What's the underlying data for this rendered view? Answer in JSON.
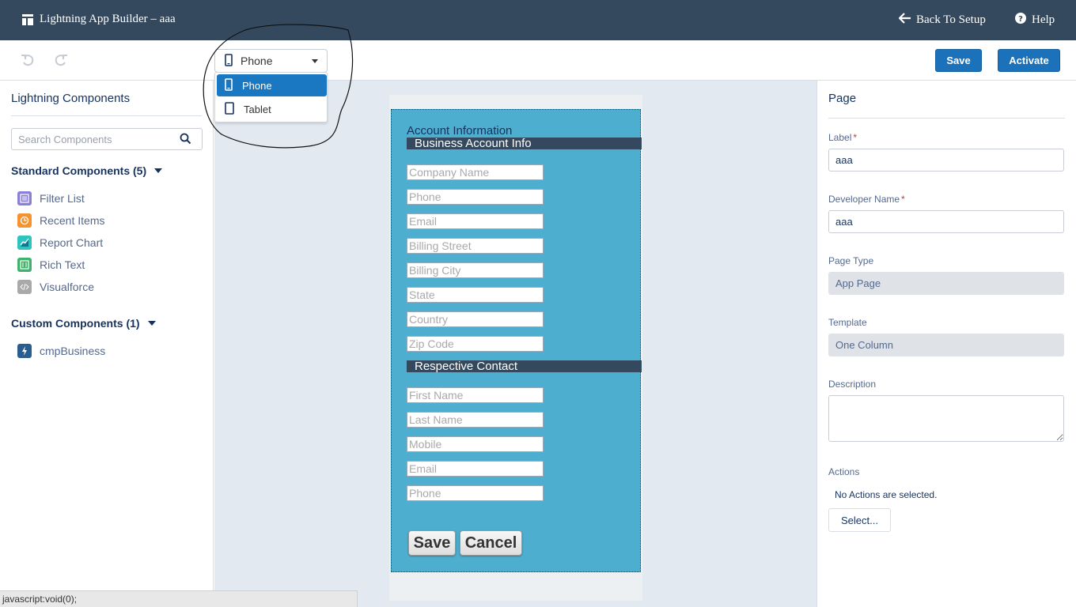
{
  "header": {
    "app_title": "Lightning App Builder – aaa",
    "back_label": "Back To Setup",
    "help_label": "Help"
  },
  "toolbar": {
    "device_selected": "Phone",
    "save_label": "Save",
    "activate_label": "Activate"
  },
  "device_menu": {
    "options": [
      "Phone",
      "Tablet"
    ],
    "selected": "Phone"
  },
  "left_panel": {
    "title": "Lightning Components",
    "search_placeholder": "Search Components",
    "standard_section": "Standard Components (5)",
    "standard_items": [
      {
        "label": "Filter List",
        "icon": "filter-list-icon",
        "color": "#8b80d4"
      },
      {
        "label": "Recent Items",
        "icon": "clock-icon",
        "color": "#f59331"
      },
      {
        "label": "Report Chart",
        "icon": "chart-icon",
        "color": "#2ec2c0"
      },
      {
        "label": "Rich Text",
        "icon": "rich-text-icon",
        "color": "#3fb26b"
      },
      {
        "label": "Visualforce",
        "icon": "code-icon",
        "color": "#a9a9a9"
      }
    ],
    "custom_section": "Custom Components (1)",
    "custom_items": [
      {
        "label": "cmpBusiness",
        "icon": "lightning-bolt-icon",
        "color": "#2a5d8f"
      }
    ]
  },
  "phone_preview": {
    "heading": "Account Information",
    "business_band": "Business Account Info",
    "business_fields": [
      "Company Name",
      "Phone",
      "Email",
      "Billing Street",
      "Billing City",
      "State",
      "Country",
      "Zip Code"
    ],
    "contact_band": "Respective Contact",
    "contact_fields": [
      "First Name",
      "Last Name",
      "Mobile",
      "Email",
      "Phone"
    ],
    "save_label": "Save",
    "cancel_label": "Cancel"
  },
  "right_panel": {
    "title": "Page",
    "label_label": "Label",
    "label_value": "aaa",
    "dev_name_label": "Developer Name",
    "dev_name_value": "aaa",
    "page_type_label": "Page Type",
    "page_type_value": "App Page",
    "template_label": "Template",
    "template_value": "One Column",
    "description_label": "Description",
    "actions_label": "Actions",
    "actions_none": "No Actions are selected.",
    "select_label": "Select..."
  },
  "status_bar": {
    "text": "javascript:void(0);"
  },
  "colors": {
    "header_bg": "#34495e",
    "brand_blue": "#1b72bb",
    "preview_card": "#4eaed0",
    "canvas_bg": "#e3e9f1"
  }
}
